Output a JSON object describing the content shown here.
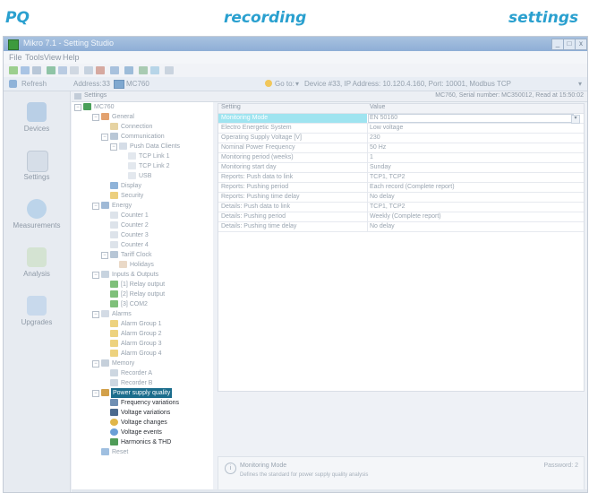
{
  "caption": {
    "left": "PQ",
    "middle": "recording",
    "right": "settings"
  },
  "window": {
    "title": "Mikro 7.1 - Setting Studio",
    "controls": [
      "_",
      "□",
      "x"
    ]
  },
  "menu": [
    "File",
    "Tools",
    "View",
    "Help"
  ],
  "addressbar": {
    "refresh": "Refresh",
    "address_label": "Address:",
    "address_value": "33",
    "device": "MC760",
    "goto": "Go to:",
    "connection": "Device #33, IP Address: 10.120.4.160, Port: 10001, Modbus TCP"
  },
  "nav": [
    "Devices",
    "Settings",
    "Measurements",
    "Analysis",
    "Upgrades"
  ],
  "settings_header": {
    "label": "Settings",
    "info": "MC760, Serial number: MC350012, Read at 15:50:02"
  },
  "tree": [
    "MC760",
    "General",
    "Connection",
    "Communication",
    "Push Data Clients",
    "TCP Link 1",
    "TCP Link 2",
    "USB",
    "Display",
    "Security",
    "Energy",
    "Counter 1",
    "Counter 2",
    "Counter 3",
    "Counter 4",
    "Tariff Clock",
    "Holidays",
    "Inputs & Outputs",
    "[1] Relay output",
    "[2] Relay output",
    "[3] COM2",
    "Alarms",
    "Alarm Group 1",
    "Alarm Group 2",
    "Alarm Group 3",
    "Alarm Group 4",
    "Memory",
    "Recorder A",
    "Recorder B",
    "Power supply quality",
    "Frequency variations",
    "Voltage variations",
    "Voltage changes",
    "Voltage events",
    "Harmonics & THD",
    "Reset"
  ],
  "grid": {
    "headers": [
      "Setting",
      "Value"
    ],
    "rows": [
      [
        "Monitoring Mode",
        "EN 50160"
      ],
      [
        "Electro Energetic System",
        "Low voltage"
      ],
      [
        "Operating Supply Voltage [V]",
        "230"
      ],
      [
        "Nominal Power Frequency",
        "50 Hz"
      ],
      [
        "Monitoring period (weeks)",
        "1"
      ],
      [
        "Monitoring start day",
        "Sunday"
      ],
      [
        "Reports: Push data to link",
        "TCP1, TCP2"
      ],
      [
        "Reports: Pushing period",
        "Each record (Complete report)"
      ],
      [
        "Reports: Pushing time delay",
        "No delay"
      ],
      [
        "Details: Push data to link",
        "TCP1, TCP2"
      ],
      [
        "Details: Pushing period",
        "Weekly (Complete report)"
      ],
      [
        "Details: Pushing time delay",
        "No delay"
      ]
    ]
  },
  "help": {
    "title": "Monitoring Mode",
    "description": "Defines the standard for power supply quality analysis",
    "password": "Password: 2"
  }
}
